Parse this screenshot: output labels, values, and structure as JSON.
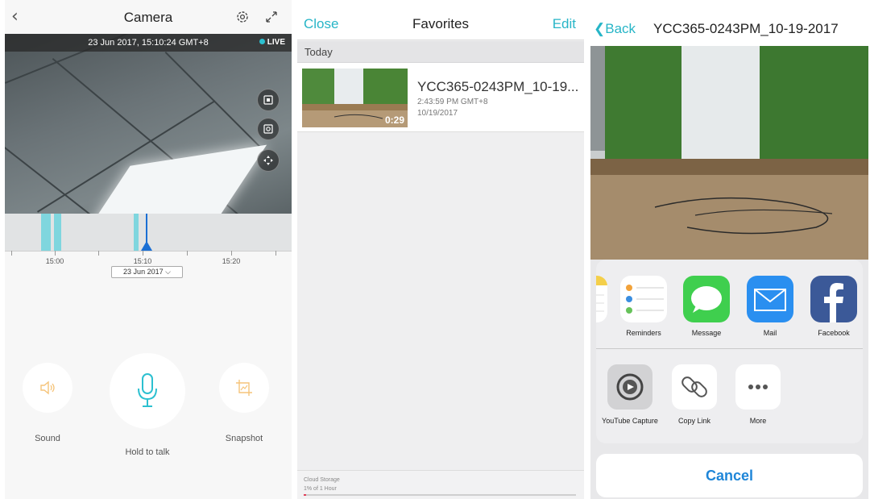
{
  "camera_screen": {
    "title": "Camera",
    "timestamp": "23 Jun 2017, 15:10:24 GMT+8",
    "live_label": "LIVE",
    "timeline_ticks": [
      "15:00",
      "15:10",
      "15:20"
    ],
    "date_value": "23 Jun 2017",
    "controls": {
      "sound_label": "Sound",
      "talk_label": "Hold to talk",
      "snapshot_label": "Snapshot"
    },
    "accent_color": "#f5c47a",
    "mic_color": "#2cc0d0",
    "icons": [
      "back-icon",
      "gear-icon",
      "expand-icon",
      "record-icon",
      "capture-icon",
      "pan-icon",
      "speaker-icon",
      "microphone-icon",
      "crop-icon"
    ]
  },
  "favorites_screen": {
    "close_label": "Close",
    "title": "Favorites",
    "edit_label": "Edit",
    "section": "Today",
    "items": [
      {
        "name": "YCC365-0243PM_10-19...",
        "time": "2:43:59 PM GMT+8",
        "date": "10/19/2017",
        "duration": "0:29"
      }
    ],
    "cloud_label": "Cloud Storage",
    "usage_label": "1% of 1 Hour",
    "usage_fraction": 0.01,
    "accent_color": "#27b5c7"
  },
  "share_screen": {
    "back_label": "Back",
    "title": "YCC365-0243PM_10-19-2017",
    "apps": [
      {
        "label": "es"
      },
      {
        "label": "Reminders"
      },
      {
        "label": "Message"
      },
      {
        "label": "Mail"
      },
      {
        "label": "Facebook"
      }
    ],
    "actions": [
      {
        "label": "YouTube Capture"
      },
      {
        "label": "Copy Link"
      },
      {
        "label": "More"
      }
    ],
    "cancel_label": "Cancel"
  }
}
